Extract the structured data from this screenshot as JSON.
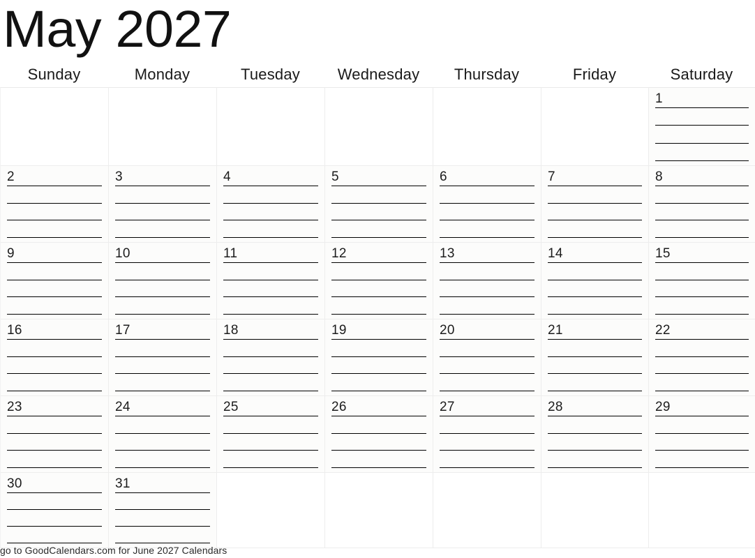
{
  "header": {
    "title": "May 2027",
    "month": "May",
    "year": "2027"
  },
  "weekdays": [
    {
      "label": "Sunday"
    },
    {
      "label": "Monday"
    },
    {
      "label": "Tuesday"
    },
    {
      "label": "Wednesday"
    },
    {
      "label": "Thursday"
    },
    {
      "label": "Friday"
    },
    {
      "label": "Saturday"
    }
  ],
  "grid": {
    "rows": 6,
    "columns": 7,
    "lines_per_day": 4,
    "first_day_column_index": 6,
    "days_in_month": 31,
    "cells": [
      {
        "date": "",
        "empty": true
      },
      {
        "date": "",
        "empty": true
      },
      {
        "date": "",
        "empty": true
      },
      {
        "date": "",
        "empty": true
      },
      {
        "date": "",
        "empty": true
      },
      {
        "date": "",
        "empty": true
      },
      {
        "date": "1",
        "empty": false
      },
      {
        "date": "2",
        "empty": false
      },
      {
        "date": "3",
        "empty": false
      },
      {
        "date": "4",
        "empty": false
      },
      {
        "date": "5",
        "empty": false
      },
      {
        "date": "6",
        "empty": false
      },
      {
        "date": "7",
        "empty": false
      },
      {
        "date": "8",
        "empty": false
      },
      {
        "date": "9",
        "empty": false
      },
      {
        "date": "10",
        "empty": false
      },
      {
        "date": "11",
        "empty": false
      },
      {
        "date": "12",
        "empty": false
      },
      {
        "date": "13",
        "empty": false
      },
      {
        "date": "14",
        "empty": false
      },
      {
        "date": "15",
        "empty": false
      },
      {
        "date": "16",
        "empty": false
      },
      {
        "date": "17",
        "empty": false
      },
      {
        "date": "18",
        "empty": false
      },
      {
        "date": "19",
        "empty": false
      },
      {
        "date": "20",
        "empty": false
      },
      {
        "date": "21",
        "empty": false
      },
      {
        "date": "22",
        "empty": false
      },
      {
        "date": "23",
        "empty": false
      },
      {
        "date": "24",
        "empty": false
      },
      {
        "date": "25",
        "empty": false
      },
      {
        "date": "26",
        "empty": false
      },
      {
        "date": "27",
        "empty": false
      },
      {
        "date": "28",
        "empty": false
      },
      {
        "date": "29",
        "empty": false
      },
      {
        "date": "30",
        "empty": false
      },
      {
        "date": "31",
        "empty": false
      },
      {
        "date": "",
        "empty": true
      },
      {
        "date": "",
        "empty": true
      },
      {
        "date": "",
        "empty": true
      },
      {
        "date": "",
        "empty": true
      },
      {
        "date": "",
        "empty": true
      }
    ]
  },
  "footer": {
    "text": "go to GoodCalendars.com for June 2027 Calendars"
  },
  "colors": {
    "text": "#111111",
    "rule": "#000000",
    "grid_line": "#ededed",
    "cell_background": "#fcfcfb",
    "page_background": "#ffffff"
  }
}
